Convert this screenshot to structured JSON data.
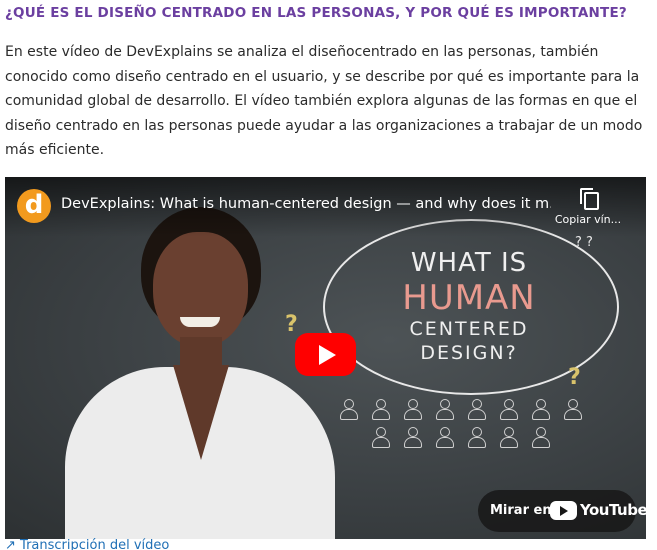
{
  "section": {
    "heading": "¿QUÉ ES EL DISEÑO CENTRADO EN LAS PERSONAS, Y POR QUÉ ES IMPORTANTE?",
    "paragraph": "En este vídeo de DevExplains se analiza el diseñocentrado en las personas, también conocido como diseño centrado en el usuario, y se describe por qué es importante para la comunidad global de desarrollo. El vídeo también explora algunas de las formas en que el diseño centrado en las personas puede ayudar a las organizaciones a trabajar de un modo más eficiente."
  },
  "video": {
    "channel_logo_letter": "d",
    "title": "DevExplains: What is human-centered design — and why does it m...",
    "copy_label": "Copiar vín...",
    "thumbnail": {
      "line1": "WHAT IS",
      "line2": "HUMAN",
      "line3": "CENTERED",
      "line4": "DESIGN?"
    },
    "watch_on_label": "Mirar en",
    "youtube_wordmark": "YouTube"
  },
  "links": {
    "transcript": "Transcripción del vídeo"
  },
  "colors": {
    "heading": "#6b3fa0",
    "play_button": "#ff0000",
    "link": "#1f6fb5",
    "channel_logo": "#f29a1e"
  }
}
